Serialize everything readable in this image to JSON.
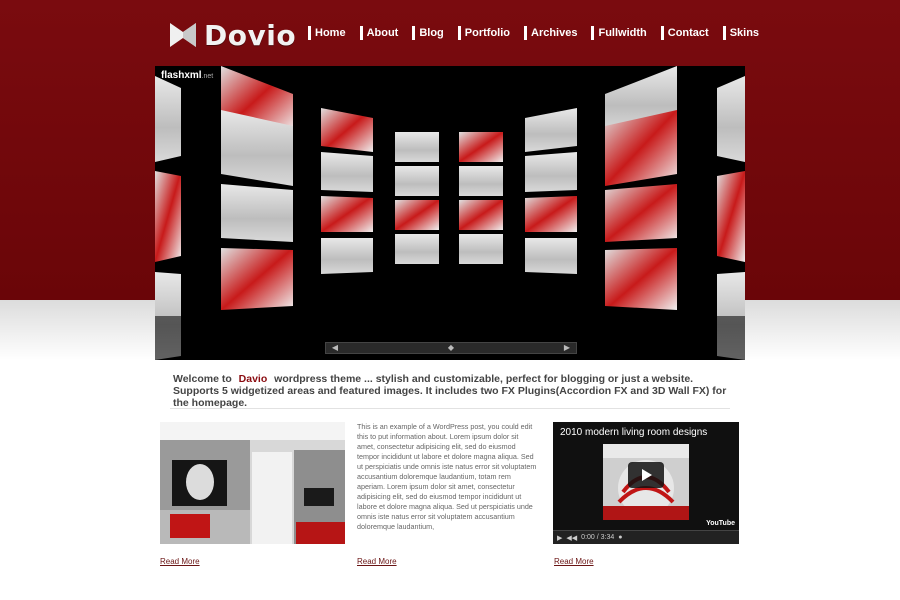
{
  "site": {
    "name": "Dovio"
  },
  "nav": {
    "items": [
      "Home",
      "About",
      "Blog",
      "Portfolio",
      "Archives",
      "Fullwidth",
      "Contact",
      "Skins"
    ]
  },
  "slider": {
    "badge": "flashxml",
    "badge_suffix": ".net",
    "controls": [
      "◀",
      "◆",
      "▶"
    ]
  },
  "welcome": {
    "prefix": "Welcome to",
    "brand": "Davio",
    "text": "wordpress theme ... stylish and customizable, perfect for blogging or just a website. Supports 5 widgetized areas and featured images. It includes two FX Plugins(Accordion FX and 3D Wall FX) for the homepage."
  },
  "post": {
    "body": "This is an example of a WordPress post, you could edit this to put information about. Lorem ipsum dolor sit amet, consectetur adipisicing elit, sed do eiusmod tempor incididunt ut labore et dolore magna aliqua. Sed ut perspiciatis unde omnis iste natus error sit voluptatem accusantium doloremque laudantium, totam rem aperiam. Lorem ipsum dolor sit amet, consectetur adipisicing elit, sed do eiusmod tempor incididunt ut labore et dolore magna aliqua. Sed ut perspiciatis unde omnis iste natus error sit voluptatem accusantium doloremque laudantium,"
  },
  "video": {
    "title": "2010 modern living room designs",
    "time": "0:00 / 3:34",
    "brand": "YouTube"
  },
  "read_more": [
    "Read More",
    "Read More",
    "Read More"
  ],
  "colors": {
    "brand": "#7a0b0f",
    "accent": "#8a0b10"
  }
}
